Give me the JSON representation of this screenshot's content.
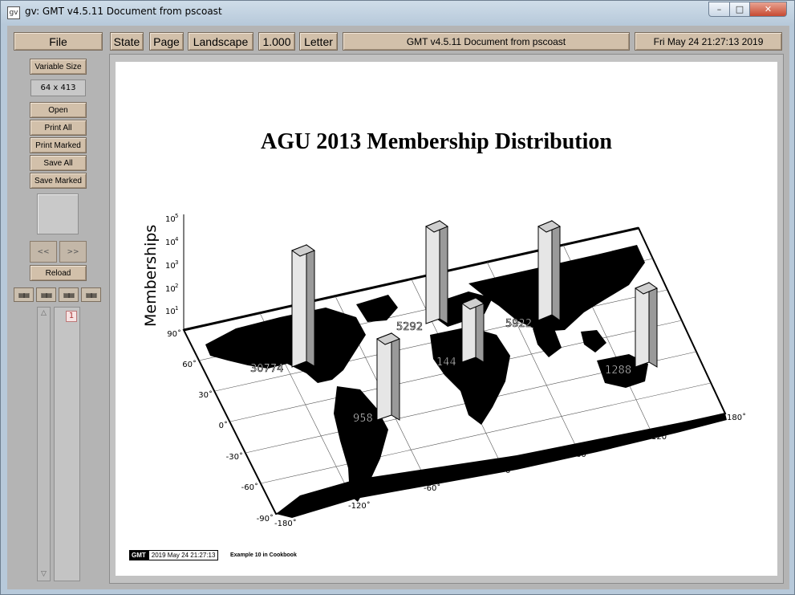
{
  "window": {
    "title": "gv: GMT v4.5.11 Document from pscoast",
    "app_icon": "gv",
    "controls": {
      "minimize": "–",
      "maximize": "□",
      "close": "✕"
    }
  },
  "toolbar": {
    "file": "File",
    "state": "State",
    "page": "Page",
    "orientation": "Landscape",
    "magnification": "1.000",
    "media": "Letter",
    "document_title": "GMT v4.5.11 Document from pscoast",
    "date": "Fri May 24 21:27:13 2019"
  },
  "sidebar": {
    "variable_size": "Variable Size",
    "size_readout": "64 x 413",
    "open": "Open",
    "print_all": "Print All",
    "print_marked": "Print Marked",
    "save_all": "Save All",
    "save_marked": "Save Marked",
    "prev": "<<",
    "next": ">>",
    "reload": "Reload",
    "mini_buttons": [
      "▤▤",
      "▤▤",
      "▤▤",
      "▤▤"
    ],
    "pages": [
      "1"
    ]
  },
  "document": {
    "title": "AGU 2013 Membership Distribution",
    "footer_logo": "GMT",
    "footer_date": "2019 May 24 21:27:13",
    "footer_caption": "Example 10 in Cookbook"
  },
  "map": {
    "z_axis_label": "Memberships",
    "z_ticks": [
      "10",
      "10",
      "10",
      "10",
      "10"
    ],
    "z_exponents": [
      "1",
      "2",
      "3",
      "4",
      "5"
    ],
    "lat_ticks": [
      "90˚",
      "60˚",
      "30˚",
      "0˚",
      "-30˚",
      "-60˚",
      "-90˚"
    ],
    "lon_ticks": [
      "-180˚",
      "-120˚",
      "-60˚",
      "0˚",
      "60˚",
      "120˚",
      "180˚"
    ],
    "bar_labels": [
      "30774",
      "958",
      "5292",
      "144",
      "5922",
      "1288"
    ]
  },
  "colors": {
    "button_face": "#d2c0aa",
    "panel_gray": "#b4b4b4",
    "bar_fill": "#e6e6e6",
    "land": "#000000"
  }
}
